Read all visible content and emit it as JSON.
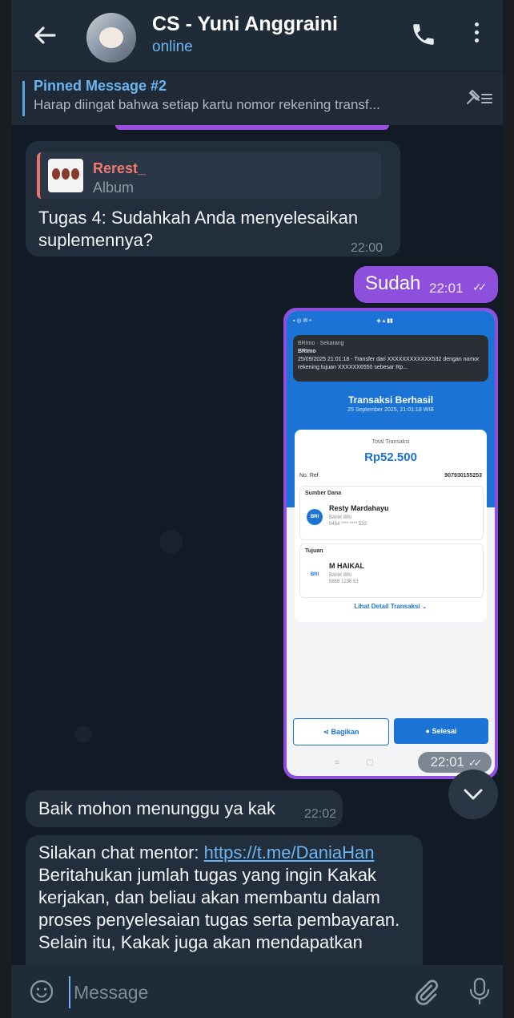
{
  "header": {
    "title": "CS - Yuni Anggraini",
    "status": "online"
  },
  "pinned": {
    "title": "Pinned Message #2",
    "text": "Harap diingat bahwa setiap kartu nomor rekening transf..."
  },
  "messages": {
    "m1": {
      "reply_name": "Rerest_",
      "reply_sub": "Album",
      "text": "Tugas 4: Sudahkah Anda menyelesaikan suplemennya?",
      "time": "22:00"
    },
    "m2": {
      "text": "Sudah",
      "time": "22:01",
      "ticks": "✓✓"
    },
    "m3": {
      "time": "22:01",
      "ticks": "✓✓",
      "image": {
        "notif_app": "BRImo · Sekarang",
        "notif_title": "BRImo",
        "notif_body": "25/09/2025 21:01:18 - Transfer dari XXXXXXXXXXXX532 dengan nomor rekening tujuan XXXXXX6550 sebesar Rp...",
        "heading": "Transaksi Berhasil",
        "date": "25 September 2025, 21:01:18 WIB",
        "total_label": "Total Transaksi",
        "amount": "Rp52.500",
        "ref_label": "No. Ref",
        "ref_value": "907930155253",
        "source_label": "Sumber Dana",
        "source_name": "Resty Mardahayu",
        "source_bank": "BANK BRI",
        "source_acct": "0454 **** **** 532",
        "dest_label": "Tujuan",
        "dest_name": "M HAIKAL",
        "dest_bank": "BANK BRI",
        "dest_acct": "5868 1236 53",
        "detail_link": "Lihat Detail Transaksi",
        "share_btn": "Bagikan",
        "done_btn": "Selesai",
        "bank_code": "BRI"
      }
    },
    "m4": {
      "text": "Baik mohon menunggu ya kak",
      "time": "22:02"
    },
    "m5": {
      "prefix": "Silakan chat mentor: ",
      "link": "https://t.me/DaniaHan",
      "body": "Beritahukan jumlah tugas yang ingin Kakak kerjakan, dan beliau akan membantu dalam proses penyelesaian tugas serta pembayaran.",
      "cut": "Selain itu, Kakak juga akan mendapatkan"
    }
  },
  "input": {
    "placeholder": "Message"
  }
}
